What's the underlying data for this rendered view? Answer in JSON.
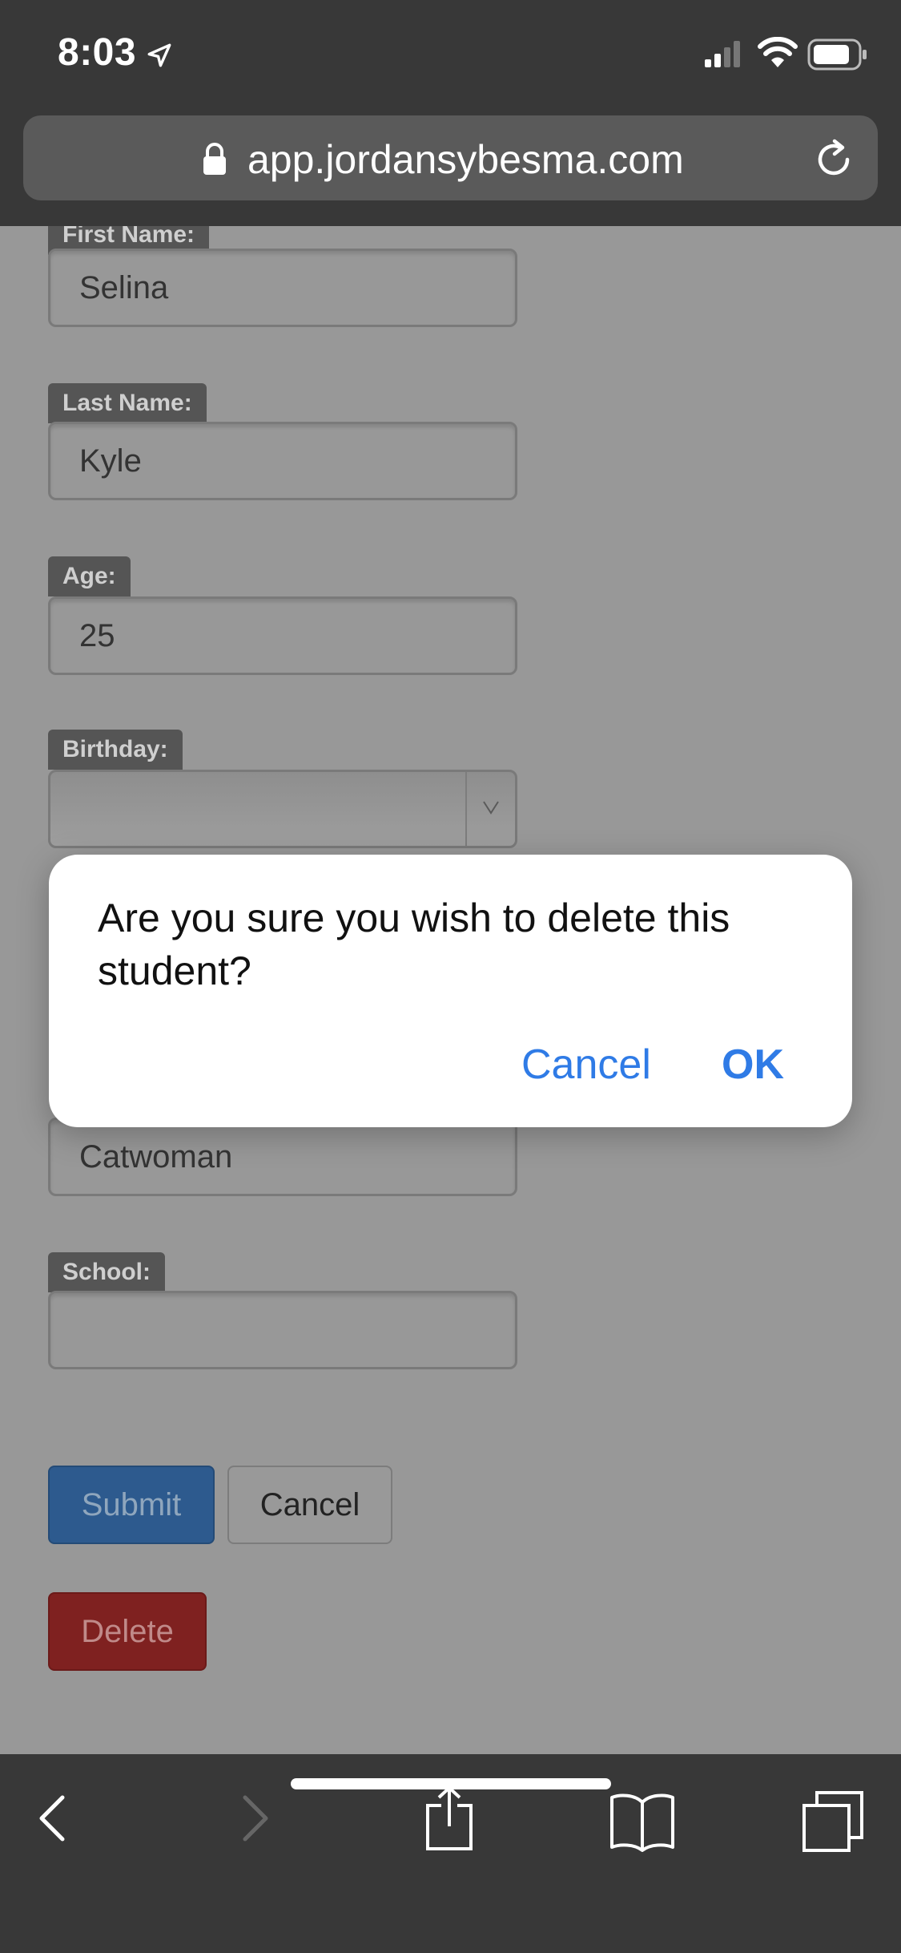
{
  "status_bar": {
    "time": "8:03",
    "icons": [
      "location-arrow-icon",
      "cellular-signal-icon",
      "wifi-icon",
      "battery-icon"
    ]
  },
  "browser": {
    "url": "app.jordansybesma.com",
    "icons": [
      "lock-icon",
      "reload-icon"
    ]
  },
  "form": {
    "first_name": {
      "label": "First Name:",
      "value": "Selina"
    },
    "last_name": {
      "label": "Last Name:",
      "value": "Kyle"
    },
    "age": {
      "label": "Age:",
      "value": "25"
    },
    "birthday": {
      "label": "Birthday:",
      "value": ""
    },
    "alias": {
      "value": "Catwoman"
    },
    "school": {
      "label": "School:",
      "value": ""
    },
    "submit_label": "Submit",
    "cancel_label": "Cancel",
    "delete_label": "Delete"
  },
  "dialog": {
    "message": "Are you sure you wish to delete this student?",
    "cancel_label": "Cancel",
    "ok_label": "OK"
  },
  "toolbar": {
    "icons": [
      "back-icon",
      "forward-icon",
      "share-icon",
      "bookmarks-icon",
      "tabs-icon"
    ]
  },
  "colors": {
    "accent": "#2f7be6",
    "submit": "#2d5a8e",
    "delete": "#7f2120",
    "chrome": "#383838"
  }
}
